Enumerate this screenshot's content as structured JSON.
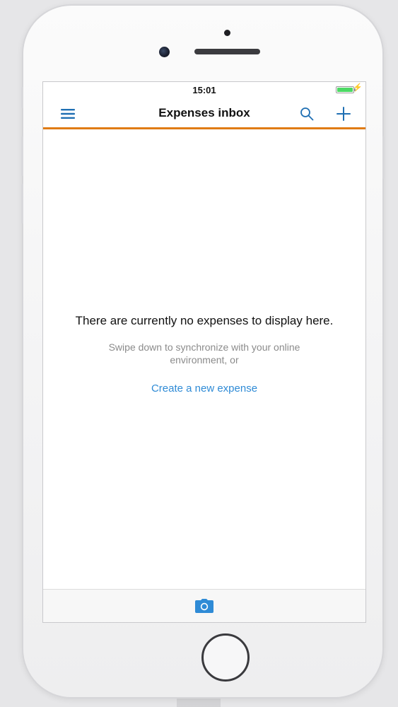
{
  "status_bar": {
    "time": "15:01",
    "battery_level": 1.0
  },
  "nav_bar": {
    "title": "Expenses inbox",
    "menu_icon": "hamburger-menu-icon",
    "search_icon": "search-icon",
    "add_icon": "plus-icon"
  },
  "empty_state": {
    "title": "There are currently no expenses to display here.",
    "subtitle": "Swipe down to synchronize with your online environment, or",
    "link_label": "Create a new expense"
  },
  "bottom_bar": {
    "camera_icon": "camera-icon"
  },
  "colors": {
    "accent_orange": "#e07b15",
    "link_blue": "#2f8bd6",
    "icon_blue": "#1f6fb3",
    "battery_green": "#4cd964"
  }
}
